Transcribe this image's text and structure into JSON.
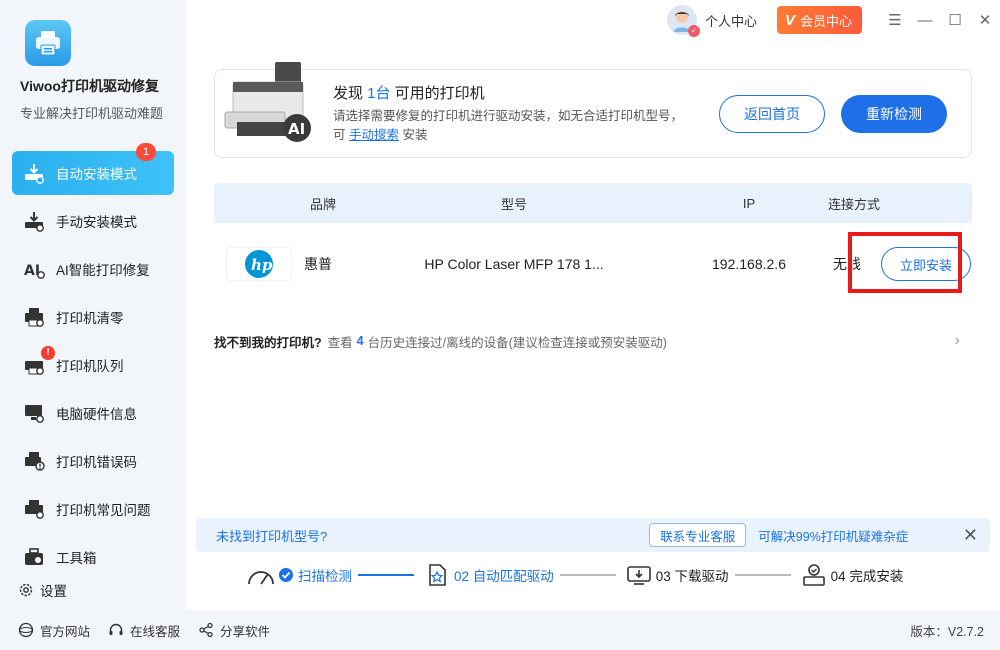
{
  "app": {
    "name": "Viwoo打印机驱动修复",
    "subtitle": "专业解决打印机驱动难题"
  },
  "sidebar": {
    "items": [
      {
        "label": "自动安装模式",
        "icon": "auto-install-icon",
        "active": true,
        "badge": "1"
      },
      {
        "label": "手动安装模式",
        "icon": "manual-install-icon"
      },
      {
        "label": "AI智能打印修复",
        "icon": "ai-repair-icon"
      },
      {
        "label": "打印机清零",
        "icon": "printer-reset-icon"
      },
      {
        "label": "打印机队列",
        "icon": "printer-queue-icon",
        "badge": "!"
      },
      {
        "label": "电脑硬件信息",
        "icon": "hardware-info-icon"
      },
      {
        "label": "打印机错误码",
        "icon": "error-code-icon"
      },
      {
        "label": "打印机常见问题",
        "icon": "faq-icon"
      },
      {
        "label": "工具箱",
        "icon": "toolbox-icon"
      }
    ],
    "settings_label": "设置"
  },
  "topbar": {
    "user_center": "个人中心",
    "vip_label": "会员中心",
    "vip_mark": "V"
  },
  "found": {
    "title_prefix": "发现 ",
    "count": "1台",
    "title_suffix": " 可用的打印机",
    "desc_part1": "请选择需要修复的打印机进行驱动安装，如无合适打印机型号，可 ",
    "desc_link": "手动搜索",
    "desc_part2": " 安装",
    "back_button": "返回首页",
    "rescan_button": "重新检测",
    "ai_badge": "AI"
  },
  "table": {
    "headers": {
      "brand": "品牌",
      "model": "型号",
      "ip": "IP",
      "connection": "连接方式"
    },
    "rows": [
      {
        "logo": "hp",
        "brand": "惠普",
        "model": "HP Color Laser MFP 178 1...",
        "ip": "192.168.2.6",
        "connection": "无线",
        "action": "立即安装"
      }
    ]
  },
  "notfound": {
    "title": "找不到我的打印机?",
    "text_pre": "查看",
    "count": "4",
    "text_post": "台历史连接过/离线的设备(建议检查连接或预安装驱动)"
  },
  "tipbar": {
    "question": "未找到打印机型号?",
    "contact_button": "联系专业客服",
    "info": "可解决99%打印机疑难杂症"
  },
  "steps": [
    {
      "label": "扫描检测",
      "done": true
    },
    {
      "label": "02 自动匹配驱动"
    },
    {
      "label": "03 下载驱动"
    },
    {
      "label": "04 完成安装"
    }
  ],
  "bottombar": {
    "website": "官方网站",
    "support": "在线客服",
    "share": "分享软件",
    "version": "版本：V2.7.2"
  },
  "colors": {
    "accent": "#1f6fe8",
    "sidebar_active": "#2ab0f0",
    "vip": "#ff6a38",
    "highlight_frame": "#e81a1a"
  }
}
